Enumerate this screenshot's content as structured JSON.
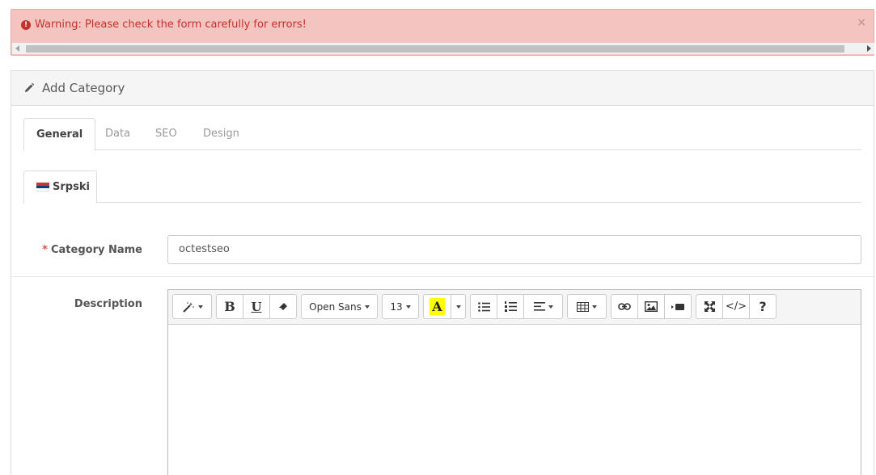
{
  "alert": {
    "message": "Warning: Please check the form carefully for errors!",
    "close": "×",
    "icon": "exclamation-circle-icon"
  },
  "panel": {
    "title": "Add Category"
  },
  "tabs": [
    {
      "label": "General",
      "active": true
    },
    {
      "label": "Data",
      "active": false
    },
    {
      "label": "SEO",
      "active": false
    },
    {
      "label": "Design",
      "active": false
    }
  ],
  "language_tab": {
    "label": "Srpski",
    "flag_colors": [
      "#c6363c",
      "#0c4076",
      "#ffffff"
    ]
  },
  "form": {
    "category_name_label": "Category Name",
    "required_marker": "*",
    "category_name_value": "octestseo",
    "description_label": "Description"
  },
  "toolbar": {
    "font_family": "Open Sans",
    "font_size": "13",
    "bold": "B",
    "underline": "U",
    "highlight": "A",
    "help": "?",
    "code": "</>"
  },
  "colors": {
    "alert_bg": "#f3c4c0",
    "alert_text": "#c9302c",
    "required_star": "#d9534f",
    "highlight_yellow": "#ffff00"
  }
}
